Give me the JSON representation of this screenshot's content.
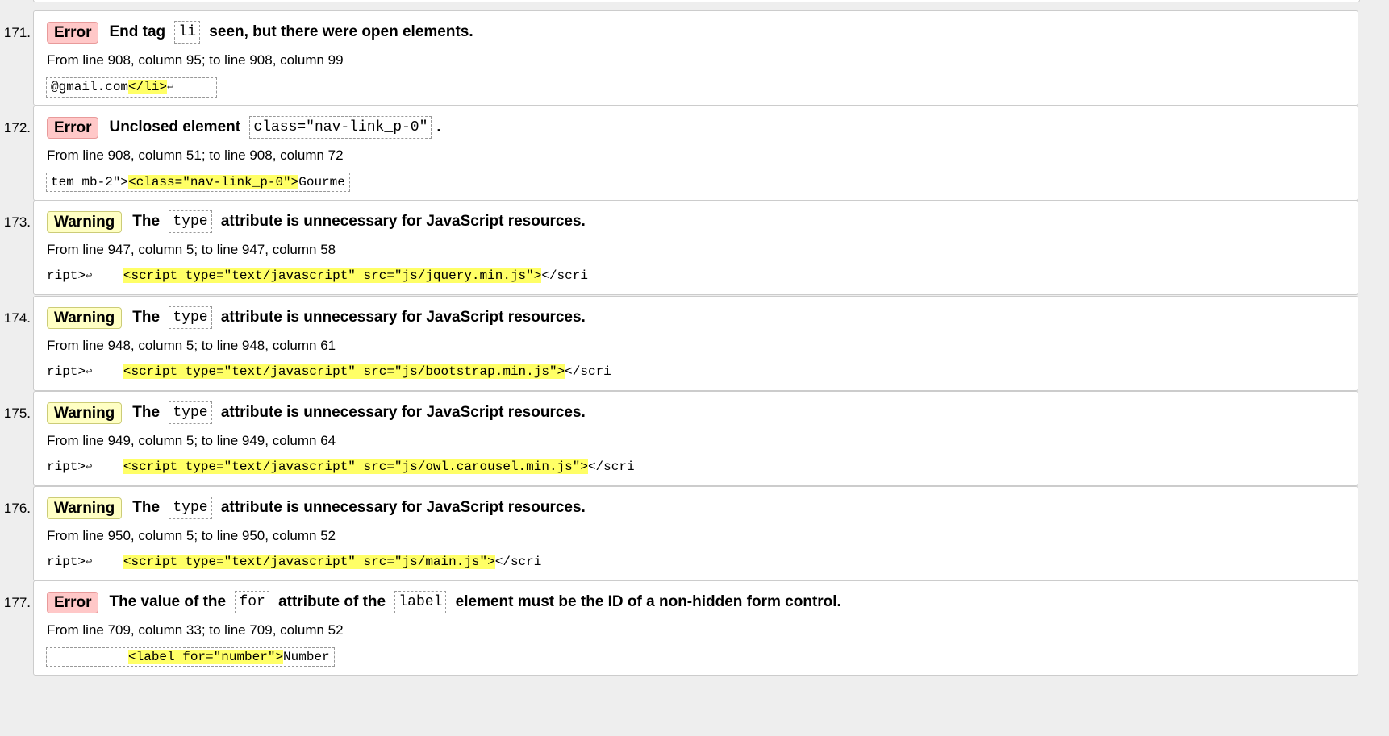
{
  "messages": [
    {
      "num": "171.",
      "type": "error",
      "type_label": "Error",
      "text_parts": [
        {
          "t": "End tag "
        },
        {
          "code": "li"
        },
        {
          "t": " seen, but there were open elements."
        }
      ],
      "location": "From line 908, column 95; to line 908, column 99",
      "extract_boxed": true,
      "extract": [
        {
          "t": "@gmail.com"
        },
        {
          "hl": "</li>"
        },
        {
          "lf": "↩"
        },
        {
          "t": "     "
        }
      ]
    },
    {
      "num": "172.",
      "type": "error",
      "type_label": "Error",
      "text_parts": [
        {
          "t": "Unclosed element "
        },
        {
          "code": "class=\"nav-link_p-0\""
        },
        {
          "t": "."
        }
      ],
      "location": "From line 908, column 51; to line 908, column 72",
      "extract_boxed": true,
      "extract": [
        {
          "t": "tem mb-2\">"
        },
        {
          "hl": "<class=\"nav-link_p-0\">"
        },
        {
          "t": "Gourme"
        }
      ]
    },
    {
      "num": "173.",
      "type": "warning",
      "type_label": "Warning",
      "text_parts": [
        {
          "t": "The "
        },
        {
          "code": "type"
        },
        {
          "t": " attribute is unnecessary for JavaScript resources."
        }
      ],
      "location": "From line 947, column 5; to line 947, column 58",
      "extract_boxed": false,
      "extract": [
        {
          "t": "ript>"
        },
        {
          "lf": "↩"
        },
        {
          "t": "    "
        },
        {
          "hl": "<script type=\"text/javascript\" src=\"js/jquery.min.js\">"
        },
        {
          "t": "</scri"
        }
      ]
    },
    {
      "num": "174.",
      "type": "warning",
      "type_label": "Warning",
      "text_parts": [
        {
          "t": "The "
        },
        {
          "code": "type"
        },
        {
          "t": " attribute is unnecessary for JavaScript resources."
        }
      ],
      "location": "From line 948, column 5; to line 948, column 61",
      "extract_boxed": false,
      "extract": [
        {
          "t": "ript>"
        },
        {
          "lf": "↩"
        },
        {
          "t": "    "
        },
        {
          "hl": "<script type=\"text/javascript\" src=\"js/bootstrap.min.js\">"
        },
        {
          "t": "</scri"
        }
      ]
    },
    {
      "num": "175.",
      "type": "warning",
      "type_label": "Warning",
      "text_parts": [
        {
          "t": "The "
        },
        {
          "code": "type"
        },
        {
          "t": " attribute is unnecessary for JavaScript resources."
        }
      ],
      "location": "From line 949, column 5; to line 949, column 64",
      "extract_boxed": false,
      "extract": [
        {
          "t": "ript>"
        },
        {
          "lf": "↩"
        },
        {
          "t": "    "
        },
        {
          "hl": "<script type=\"text/javascript\" src=\"js/owl.carousel.min.js\">"
        },
        {
          "t": "</scri"
        }
      ]
    },
    {
      "num": "176.",
      "type": "warning",
      "type_label": "Warning",
      "text_parts": [
        {
          "t": "The "
        },
        {
          "code": "type"
        },
        {
          "t": " attribute is unnecessary for JavaScript resources."
        }
      ],
      "location": "From line 950, column 5; to line 950, column 52",
      "extract_boxed": false,
      "extract": [
        {
          "t": "ript>"
        },
        {
          "lf": "↩"
        },
        {
          "t": "    "
        },
        {
          "hl": "<script type=\"text/javascript\" src=\"js/main.js\">"
        },
        {
          "t": "</scri"
        }
      ]
    },
    {
      "num": "177.",
      "type": "error",
      "type_label": "Error",
      "text_parts": [
        {
          "t": "The value of the "
        },
        {
          "code": "for"
        },
        {
          "t": " attribute of the "
        },
        {
          "code": "label"
        },
        {
          "t": " element must be the ID of a non-hidden form control."
        }
      ],
      "location": "From line 709, column 33; to line 709, column 52",
      "extract_boxed": true,
      "extract": [
        {
          "t": "          "
        },
        {
          "hl": "<label for=\"number\">"
        },
        {
          "t": "Number"
        }
      ]
    }
  ]
}
